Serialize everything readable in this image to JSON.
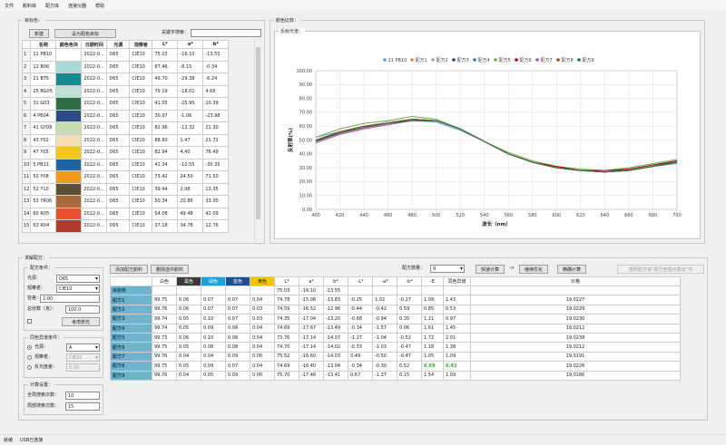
{
  "menu": [
    "文件",
    "颜料库",
    "配方库",
    "连接仪器",
    "帮助"
  ],
  "left_panel": {
    "title": "目标色：",
    "new_btn": "新建",
    "set_btn": "设为配色目标",
    "search_label": "关键字搜索：",
    "search_value": ""
  },
  "color_table": {
    "headers": [
      "名称",
      "颜色色块",
      "日期时间",
      "光源",
      "观察者",
      "L*",
      "a*",
      "b*"
    ],
    "rows": [
      {
        "n": "1",
        "name": "11 PB10",
        "color": "#ffffff",
        "date": "2022-0...",
        "illum": "D65",
        "obs": "CIE10",
        "L": "75.03",
        "a": "-16.10",
        "b": "-13.55"
      },
      {
        "n": "2",
        "name": "12 B06",
        "color": "#a9d9d7",
        "date": "2022-0...",
        "illum": "D65",
        "obs": "CIE10",
        "L": "87.46",
        "a": "-8.15",
        "b": "-0.34"
      },
      {
        "n": "3",
        "name": "21 BT5",
        "color": "#168a8e",
        "date": "2022-0...",
        "illum": "D65",
        "obs": "CIE10",
        "L": "49.70",
        "a": "-29.38",
        "b": "-6.24"
      },
      {
        "n": "4",
        "name": "25 BG05",
        "color": "#bfe0d6",
        "date": "2022-0...",
        "illum": "D65",
        "obs": "CIE10",
        "L": "79.19",
        "a": "-18.01",
        "b": "4.66"
      },
      {
        "n": "5",
        "name": "31 G03",
        "color": "#2f6e44",
        "date": "2022-0...",
        "illum": "D65",
        "obs": "CIE10",
        "L": "41.05",
        "a": "-25.95",
        "b": "10.39"
      },
      {
        "n": "6",
        "name": "4 PB04",
        "color": "#2b4b83",
        "date": "2022-0...",
        "illum": "D65",
        "obs": "CIE10",
        "L": "30.97",
        "a": "-1.06",
        "b": "-23.98"
      },
      {
        "n": "7",
        "name": "41 GY08",
        "color": "#c8dcb4",
        "date": "2022-0...",
        "illum": "D65",
        "obs": "CIE10",
        "L": "82.96",
        "a": "-12.32",
        "b": "21.30"
      },
      {
        "n": "8",
        "name": "43 Y02",
        "color": "#f5ddb4",
        "date": "2022-0...",
        "illum": "D65",
        "obs": "CIE10",
        "L": "88.60",
        "a": "1.47",
        "b": "21.72"
      },
      {
        "n": "9",
        "name": "47 Y05",
        "color": "#f3c61f",
        "date": "2022-0...",
        "illum": "D65",
        "obs": "CIE10",
        "L": "82.94",
        "a": "4.40",
        "b": "76.49"
      },
      {
        "n": "10",
        "name": "5 PB11",
        "color": "#1f64a6",
        "date": "2022-0...",
        "illum": "D65",
        "obs": "CIE10",
        "L": "41.34",
        "a": "-10.55",
        "b": "-30.35"
      },
      {
        "n": "11",
        "name": "50 Y08",
        "color": "#ef9c1e",
        "date": "2022-0...",
        "illum": "D65",
        "obs": "CIE10",
        "L": "73.42",
        "a": "24.50",
        "b": "71.50"
      },
      {
        "n": "12",
        "name": "52 Y10",
        "color": "#5d4f35",
        "date": "2022-0...",
        "illum": "D65",
        "obs": "CIE10",
        "L": "39.44",
        "a": "2.98",
        "b": "13.35"
      },
      {
        "n": "13",
        "name": "53 YR06",
        "color": "#a8693c",
        "date": "2022-0...",
        "illum": "D65",
        "obs": "CIE10",
        "L": "50.34",
        "a": "20.86",
        "b": "33.00"
      },
      {
        "n": "14",
        "name": "60 R05",
        "color": "#e7522d",
        "date": "2022-0...",
        "illum": "D65",
        "obs": "CIE10",
        "L": "54.08",
        "a": "49.48",
        "b": "42.09"
      },
      {
        "n": "15",
        "name": "63 R04",
        "color": "#b03a2c",
        "date": "2022-0...",
        "illum": "D65",
        "obs": "CIE10",
        "L": "37.18",
        "a": "34.78",
        "b": "12.76"
      }
    ]
  },
  "right_panel": {
    "title": "颜色比较：",
    "sub_title": "反射光谱："
  },
  "chart_data": {
    "type": "line",
    "ylabel": "反射率(%)",
    "xlabel": "波长（nm）",
    "ylim": [
      0,
      100
    ],
    "xlim": [
      400,
      700
    ],
    "yticks": [
      "0.00",
      "10.00",
      "20.00",
      "30.00",
      "40.00",
      "50.00",
      "60.00",
      "70.00",
      "80.00",
      "90.00",
      "100.00"
    ],
    "xticks": [
      "400",
      "420",
      "440",
      "460",
      "480",
      "500",
      "520",
      "540",
      "560",
      "580",
      "600",
      "620",
      "640",
      "660",
      "680",
      "700"
    ],
    "x": [
      400,
      420,
      440,
      460,
      480,
      500,
      520,
      540,
      560,
      580,
      600,
      620,
      640,
      660,
      680,
      700
    ],
    "series": [
      {
        "name": "11 PB10",
        "color": "#5b9bd5",
        "values": [
          52,
          56,
          60,
          62,
          64,
          63,
          57,
          49,
          40,
          34,
          30,
          28,
          27,
          28,
          31,
          33
        ]
      },
      {
        "name": "配方1",
        "color": "#ed7d31",
        "values": [
          49,
          55,
          59,
          62,
          65,
          64,
          58,
          49,
          40,
          34,
          30,
          28,
          27,
          28,
          31,
          34
        ]
      },
      {
        "name": "配方2",
        "color": "#a5a5a5",
        "values": [
          50,
          56,
          60,
          63,
          65,
          64,
          58,
          49,
          40,
          34,
          30,
          28,
          27,
          28,
          31,
          34
        ]
      },
      {
        "name": "配方3",
        "color": "#264478",
        "values": [
          49,
          56,
          60,
          62,
          65,
          64,
          58,
          49,
          40,
          34,
          30,
          28,
          27,
          28,
          31,
          35
        ]
      },
      {
        "name": "配方4",
        "color": "#4472c4",
        "values": [
          50,
          55,
          60,
          62,
          65,
          64,
          58,
          49,
          40,
          34,
          30,
          28,
          27,
          29,
          32,
          35
        ]
      },
      {
        "name": "配方5",
        "color": "#70ad47",
        "values": [
          52,
          58,
          62,
          64,
          67,
          65,
          58,
          49,
          41,
          35,
          31,
          29,
          28,
          30,
          33,
          36
        ]
      },
      {
        "name": "配方6",
        "color": "#c00000",
        "values": [
          49,
          55,
          59,
          62,
          64,
          64,
          58,
          49,
          40,
          34,
          31,
          28,
          28,
          29,
          32,
          35
        ]
      },
      {
        "name": "配方7",
        "color": "#bf40bf",
        "values": [
          48,
          54,
          58,
          61,
          64,
          64,
          58,
          49,
          40,
          34,
          30,
          28,
          27,
          28,
          31,
          34
        ]
      },
      {
        "name": "配方8",
        "color": "#9e480e",
        "values": [
          50,
          56,
          60,
          62,
          65,
          64,
          58,
          49,
          40,
          34,
          30,
          28,
          27,
          28,
          31,
          34
        ]
      },
      {
        "name": "配方9",
        "color": "#1e7b34",
        "values": [
          49,
          55,
          59,
          62,
          64,
          64,
          58,
          49,
          40,
          34,
          30,
          28,
          27,
          28,
          31,
          34
        ]
      }
    ]
  },
  "bottom_panel": {
    "title": "求解配方：",
    "condition": {
      "title": "配方条件：",
      "illum_label": "光源：",
      "illum_value": "D65",
      "obs_label": "观察者：",
      "obs_value": "CIE10",
      "tol_label": "容差：",
      "tol_value": "2.00",
      "total_label": "总份数（克）：",
      "total_value": "100.0",
      "fluor_btn": "考虑荧光"
    },
    "illum_cond": {
      "title": "同色异谱条件：",
      "r1": "光源：",
      "r1_value": "A",
      "r2": "观察者：",
      "r2_value": "CIE10",
      "r3": "反光度差：",
      "r3_value": "0.00"
    },
    "calc": {
      "title": "计算设置：",
      "g1": "全局搜索次数：",
      "g1_value": "10",
      "g2": "局部搜索次数：",
      "g2_value": "15"
    },
    "add_btn": "添加配方颜料",
    "del_btn": "删除选中颜料",
    "count_label": "配方数量：",
    "count_value": "9",
    "quick_btn": "快速计算",
    "arrow": "->",
    "next_btn": "继续优化",
    "exact_btn": "精确计算",
    "right_btn": "按照配方将“配方管理示意法”中",
    "table": {
      "headers": [
        "",
        "白色",
        "黑色",
        "绿色",
        "蓝色",
        "黄色",
        "L*",
        "a*",
        "b*",
        "-L*",
        "-a*",
        "-b*",
        "-E",
        "同色异谱",
        "价格"
      ],
      "header_colors": [
        "#ffffff",
        "#ffffff",
        "#3a3a3a",
        "#1ea0d6",
        "#1f4e8c",
        "#f5c400",
        "#ffffff",
        "#ffffff",
        "#ffffff",
        "#ffffff",
        "#ffffff",
        "#ffffff",
        "#ffffff",
        "#ffffff",
        "#ffffff"
      ],
      "rows": [
        [
          "目标色",
          "",
          "",
          "",
          "",
          "",
          "75.03",
          "-16.10",
          "-13.55",
          "",
          "",
          "",
          "",
          "",
          ""
        ],
        [
          "配方1",
          "99.75",
          "0.06",
          "0.07",
          "0.07",
          "0.04",
          "74.78",
          "-15.08",
          "-13.83",
          "-0.25",
          "1.02",
          "-0.27",
          "1.09",
          "1.43",
          "19.0227"
        ],
        [
          "配方2",
          "99.76",
          "0.06",
          "0.07",
          "0.07",
          "0.03",
          "74.59",
          "-16.52",
          "-12.96",
          "-0.44",
          "-0.42",
          "0.59",
          "0.85",
          "0.53",
          "19.0229"
        ],
        [
          "配方3",
          "99.74",
          "0.05",
          "0.10",
          "0.07",
          "0.03",
          "74.35",
          "-17.04",
          "-13.20",
          "-0.68",
          "-0.94",
          "0.35",
          "1.21",
          "0.97",
          "19.0230"
        ],
        [
          "配方4",
          "99.74",
          "0.05",
          "0.09",
          "0.08",
          "0.04",
          "74.69",
          "-17.67",
          "-13.49",
          "-0.34",
          "-1.57",
          "0.06",
          "1.61",
          "1.45",
          "19.0212"
        ],
        [
          "配方5",
          "99.73",
          "0.06",
          "0.10",
          "0.08",
          "0.04",
          "73.76",
          "-17.14",
          "-14.07",
          "-1.27",
          "-1.04",
          "-0.52",
          "1.72",
          "2.01",
          "19.0238"
        ],
        [
          "配方6",
          "99.75",
          "0.05",
          "0.08",
          "0.08",
          "0.04",
          "74.70",
          "-17.14",
          "-14.02",
          "-0.33",
          "-1.03",
          "-0.47",
          "1.18",
          "1.38",
          "19.0212"
        ],
        [
          "配方7",
          "99.76",
          "0.04",
          "0.04",
          "0.09",
          "0.06",
          "75.52",
          "-16.60",
          "-14.03",
          "0.49",
          "-0.50",
          "-0.47",
          "1.05",
          "1.09",
          "19.0191"
        ],
        [
          "配方8",
          "99.75",
          "0.05",
          "0.09",
          "0.07",
          "0.04",
          "74.69",
          "-16.40",
          "-13.04",
          "-0.34",
          "-0.30",
          "0.52",
          "0.69",
          "0.43",
          "19.0226"
        ],
        [
          "配方9",
          "99.76",
          "0.04",
          "0.05",
          "0.09",
          "0.06",
          "75.70",
          "-17.48",
          "-13.41",
          "0.67",
          "-1.37",
          "0.15",
          "1.54",
          "1.09",
          "19.0186"
        ]
      ]
    }
  },
  "status": {
    "left": "就绪",
    "right": "USB已连接"
  }
}
